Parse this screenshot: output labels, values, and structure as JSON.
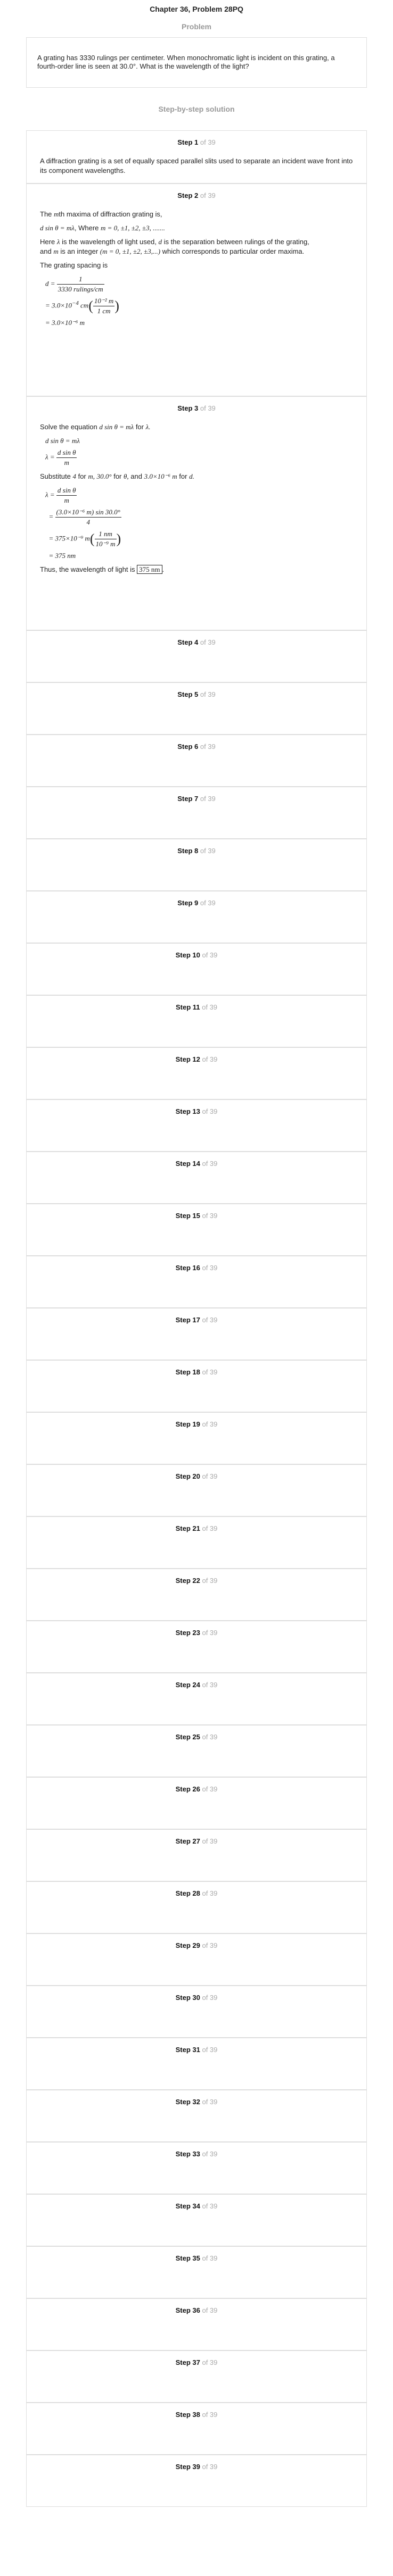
{
  "title": "Chapter 36, Problem 28PQ",
  "problem": {
    "heading": "Problem",
    "text": "A grating has 3330 rulings per centimeter. When monochromatic light is incident on this grating, a fourth-order line is seen at 30.0°. What is the wavelength of the light?"
  },
  "solution_heading": "Step-by-step solution",
  "step_word": "Step",
  "of_total": "of 39",
  "step1": {
    "text": "A diffraction grating is a set of equally spaced parallel slits used to separate an incident wave front into its component wavelengths."
  },
  "step2": {
    "intro_a": "The",
    "intro_m": "m",
    "intro_b": "th maxima of diffraction grating is,",
    "eq1": "d sin θ = mλ",
    "where": ", Where",
    "mvals": "m = 0, ±1, ±2, ±3, .......",
    "here_a": "Here",
    "lambda": "λ",
    "here_b": "is the wavelength of light used,",
    "d": "d",
    "here_c": "is the separation between rulings of the grating,",
    "and_a": "and",
    "m": "m",
    "and_b": "is an integer",
    "mvals2": "(m = 0, ±1, ±2, ±3,...)",
    "and_c": "which corresponds to particular order maxima.",
    "spacing": "The grating spacing is",
    "d_eq": "d =",
    "d_num": "1",
    "d_den": "3330 rulings/cm",
    "line2_a": "= 3.0×10",
    "line2_exp": "−4",
    "line2_b": "cm",
    "conv_num": "10⁻² m",
    "conv_den": "1 cm",
    "line3": "= 3.0×10⁻⁶ m"
  },
  "step3": {
    "solve_a": "Solve the equation",
    "solve_eq": "d sin θ = mλ",
    "solve_b": "for",
    "solve_var": "λ.",
    "eq1": "d sin θ = mλ",
    "lam_eq": "λ =",
    "lam_num": "d sin θ",
    "lam_den": "m",
    "subst_a": "Substitute",
    "subst_4": "4",
    "subst_b": "for",
    "subst_m": "m,",
    "subst_30": "30.0°",
    "subst_c": "for",
    "subst_th": "θ,",
    "subst_d": "and",
    "subst_dval": "3.0×10⁻⁶ m",
    "subst_e": "for",
    "subst_dvar": "d.",
    "calc1_num": "d sin θ",
    "calc1_den": "m",
    "calc2_num": "(3.0×10⁻⁶ m) sin 30.0°",
    "calc2_den": "4",
    "calc3_a": "= 375×10⁻⁹ m",
    "calc3_num": "1 nm",
    "calc3_den": "10⁻⁹ m",
    "calc4": "= 375 nm",
    "thus": "Thus, the wavelength of light is",
    "answer": "375 nm",
    "period": "."
  },
  "empty_steps": [
    "4",
    "5",
    "6",
    "7",
    "8",
    "9",
    "10",
    "11",
    "12",
    "13",
    "14",
    "15",
    "16",
    "17",
    "18",
    "19",
    "20",
    "21",
    "22",
    "23",
    "24",
    "25",
    "26",
    "27",
    "28",
    "29",
    "30",
    "31",
    "32",
    "33",
    "34",
    "35",
    "36",
    "37",
    "38",
    "39"
  ]
}
